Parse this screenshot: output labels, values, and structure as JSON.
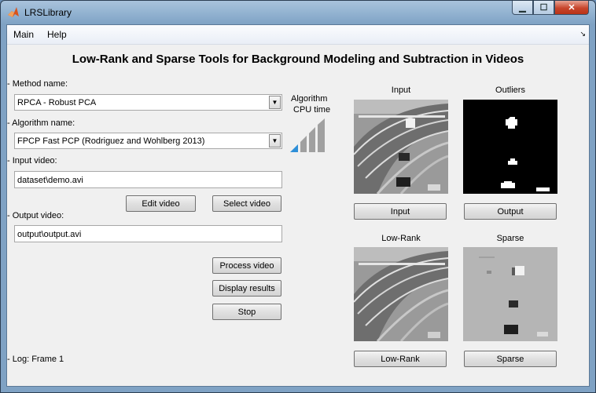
{
  "window": {
    "title": "LRSLibrary"
  },
  "menu": {
    "main": "Main",
    "help": "Help"
  },
  "heading": "Low-Rank and Sparse Tools for Background Modeling and Subtraction in Videos",
  "method": {
    "label": "Method name:",
    "value": "RPCA - Robust PCA"
  },
  "algorithm": {
    "label": "Algorithm name:",
    "value": "FPCP Fast PCP (Rodriguez and Wohlberg 2013)"
  },
  "cpu": {
    "label_line1": "Algorithm",
    "label_line2": "CPU time",
    "level": 1,
    "max_level": 4
  },
  "input_video": {
    "label": "Input video:",
    "value": "dataset\\demo.avi"
  },
  "output_video": {
    "label": "Output video:",
    "value": "output\\output.avi"
  },
  "buttons": {
    "edit_video": "Edit video",
    "select_video": "Select video",
    "process_video": "Process video",
    "display_results": "Display results",
    "stop": "Stop",
    "input": "Input",
    "output": "Output",
    "low_rank": "Low-Rank",
    "sparse": "Sparse"
  },
  "panels": {
    "input": "Input",
    "outliers": "Outliers",
    "low_rank": "Low-Rank",
    "sparse": "Sparse"
  },
  "log": "Log: Frame 1",
  "colors": {
    "titlebar": "#8fb0cf",
    "client_bg": "#f0f0f0",
    "close_button": "#c7452c",
    "cpu_active": "#2e8fd8",
    "cpu_inactive": "#a0a0a0"
  }
}
